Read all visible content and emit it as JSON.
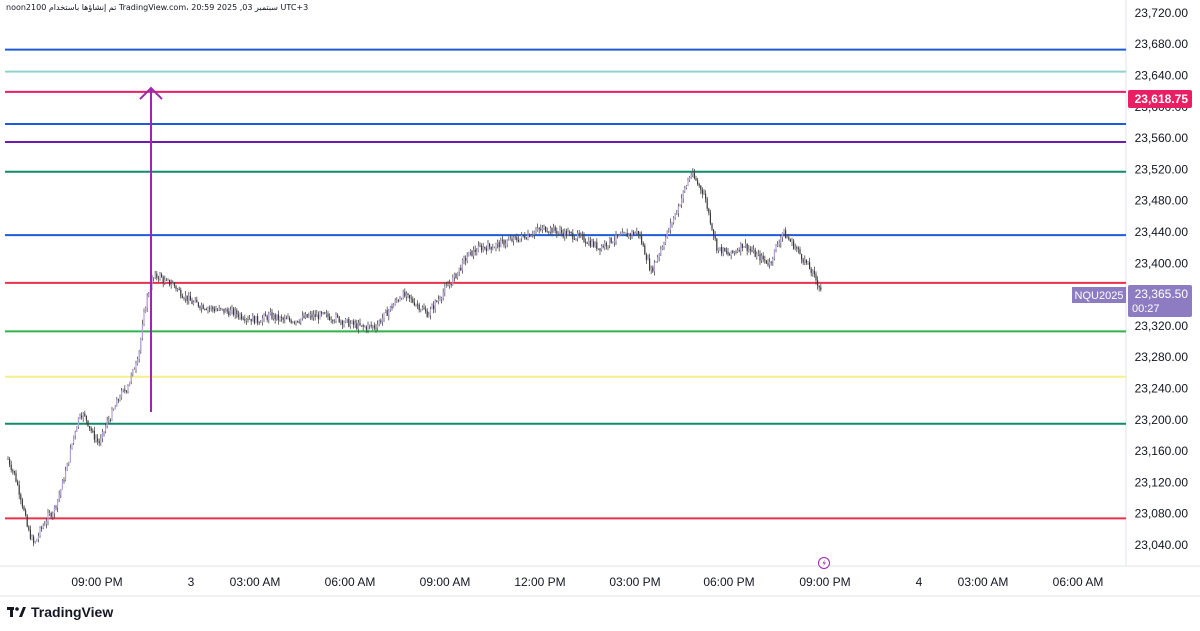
{
  "watermark": "noon2100 تم إنشاؤها باستخدام TradingView.com، 20:59 2025 ,03 سبتمبر UTC+3",
  "brand": "TradingView",
  "chart_data": {
    "type": "candlestick",
    "symbol": "NQU2025",
    "last_price": "23,365.50",
    "countdown": "00:27",
    "highlighted_level_label": "23,618.75",
    "y_range": [
      23025,
      23730
    ],
    "y_ticks": [
      23040,
      23080,
      23120,
      23160,
      23200,
      23240,
      23280,
      23320,
      23360,
      23400,
      23440,
      23480,
      23520,
      23560,
      23600,
      23640,
      23680,
      23720
    ],
    "y_tick_labels": [
      "23,040.00",
      "23,080.00",
      "23,120.00",
      "23,160.00",
      "23,200.00",
      "23,240.00",
      "23,280.00",
      "23,320.00",
      "",
      "23,400.00",
      "23,440.00",
      "23,480.00",
      "23,520.00",
      "23,560.00",
      "23,600.00",
      "23,640.00",
      "23,680.00",
      "23,720.00"
    ],
    "x_labels": [
      "09:00 PM",
      "3",
      "03:00 AM",
      "06:00 AM",
      "09:00 AM",
      "12:00 PM",
      "03:00 PM",
      "06:00 PM",
      "09:00 PM",
      "4",
      "03:00 AM",
      "06:00 AM"
    ],
    "horizontal_levels": [
      {
        "price": 23673,
        "color": "#1e5bd8"
      },
      {
        "price": 23645,
        "color": "#8fd3cf"
      },
      {
        "price": 23619,
        "color": "#e91e63"
      },
      {
        "price": 23578,
        "color": "#1e5bd8"
      },
      {
        "price": 23555,
        "color": "#6a1bb0"
      },
      {
        "price": 23517,
        "color": "#0f8a6a"
      },
      {
        "price": 23436,
        "color": "#1e5bd8"
      },
      {
        "price": 23375,
        "color": "#e8314a"
      },
      {
        "price": 23313,
        "color": "#2fb34a"
      },
      {
        "price": 23255,
        "color": "#f4f08a"
      },
      {
        "price": 23195,
        "color": "#0f8a6a"
      },
      {
        "price": 23074,
        "color": "#e8314a"
      }
    ],
    "arrow": {
      "from_price": 23210,
      "to_price": 23624,
      "color": "#9c27b0"
    },
    "price_path": [
      [
        0,
        23150
      ],
      [
        0.5,
        23130
      ],
      [
        1,
        23100
      ],
      [
        1.5,
        23060
      ],
      [
        2,
        23040
      ],
      [
        2.5,
        23060
      ],
      [
        3,
        23075
      ],
      [
        3.5,
        23085
      ],
      [
        4,
        23110
      ],
      [
        4.5,
        23140
      ],
      [
        5,
        23180
      ],
      [
        5.5,
        23210
      ],
      [
        6,
        23200
      ],
      [
        6.5,
        23180
      ],
      [
        7,
        23170
      ],
      [
        7.5,
        23195
      ],
      [
        8,
        23210
      ],
      [
        8.5,
        23230
      ],
      [
        9,
        23240
      ],
      [
        9.5,
        23260
      ],
      [
        10,
        23290
      ],
      [
        10.5,
        23350
      ],
      [
        11,
        23380
      ],
      [
        11.5,
        23385
      ],
      [
        12,
        23375
      ],
      [
        12.5,
        23375
      ],
      [
        13,
        23365
      ],
      [
        14,
        23350
      ],
      [
        15,
        23345
      ],
      [
        16,
        23340
      ],
      [
        17,
        23338
      ],
      [
        18,
        23332
      ],
      [
        19,
        23327
      ],
      [
        20,
        23333
      ],
      [
        21,
        23327
      ],
      [
        22,
        23328
      ],
      [
        23,
        23332
      ],
      [
        24,
        23333
      ],
      [
        25,
        23330
      ],
      [
        26,
        23323
      ],
      [
        27,
        23318
      ],
      [
        28,
        23320
      ],
      [
        29,
        23340
      ],
      [
        30,
        23360
      ],
      [
        31,
        23350
      ],
      [
        32,
        23335
      ],
      [
        33,
        23360
      ],
      [
        34,
        23382
      ],
      [
        35,
        23410
      ],
      [
        36,
        23420
      ],
      [
        37,
        23422
      ],
      [
        38,
        23428
      ],
      [
        39,
        23432
      ],
      [
        40,
        23440
      ],
      [
        41,
        23445
      ],
      [
        42,
        23440
      ],
      [
        43,
        23436
      ],
      [
        44,
        23430
      ],
      [
        45,
        23420
      ],
      [
        46,
        23430
      ],
      [
        47,
        23436
      ],
      [
        48,
        23440
      ],
      [
        49,
        23390
      ],
      [
        50,
        23430
      ],
      [
        51,
        23470
      ],
      [
        52,
        23515
      ],
      [
        53,
        23490
      ],
      [
        54,
        23420
      ],
      [
        55,
        23410
      ],
      [
        56,
        23425
      ],
      [
        57,
        23410
      ],
      [
        58,
        23400
      ],
      [
        59,
        23440
      ],
      [
        60,
        23420
      ],
      [
        61,
        23395
      ],
      [
        62,
        23365
      ]
    ]
  }
}
